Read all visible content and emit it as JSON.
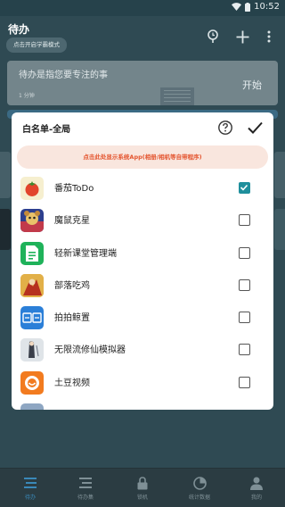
{
  "status_bar": {
    "time": "10:52"
  },
  "header": {
    "title": "待办",
    "study_mode_label": "点击开启学霸模式"
  },
  "cards": [
    {
      "title": "待办是指您要专注的事",
      "duration": "1 分钟",
      "action": "开始"
    }
  ],
  "bottom_nav": [
    {
      "label": "待办",
      "icon": "list-icon",
      "active": true
    },
    {
      "label": "待办集",
      "icon": "checklist-icon",
      "active": false
    },
    {
      "label": "锁机",
      "icon": "lock-icon",
      "active": false
    },
    {
      "label": "统计数据",
      "icon": "pie-chart-icon",
      "active": false
    },
    {
      "label": "我的",
      "icon": "person-icon",
      "active": false
    }
  ],
  "modal": {
    "title": "白名单-全局",
    "system_apps_button": "点击此处显示系统App(相册/相机等自带程序)",
    "apps": [
      {
        "name": "番茄ToDo",
        "icon": "tomato-icon",
        "checked": true
      },
      {
        "name": "魔鼠克星",
        "icon": "game-rat-icon",
        "checked": false
      },
      {
        "name": "轻新课堂管理端",
        "icon": "classroom-icon",
        "checked": false
      },
      {
        "name": "部落吃鸡",
        "icon": "game-battle-icon",
        "checked": false
      },
      {
        "name": "拍拍鲸置",
        "icon": "paipai-icon",
        "checked": false
      },
      {
        "name": "无限流修仙模拟器",
        "icon": "xiuxian-icon",
        "checked": false
      },
      {
        "name": "土豆视频",
        "icon": "tudou-icon",
        "checked": false
      }
    ]
  },
  "colors": {
    "accent": "#1f8f9c",
    "warning_text": "#e4552f",
    "nav_active": "#3a89b9"
  }
}
